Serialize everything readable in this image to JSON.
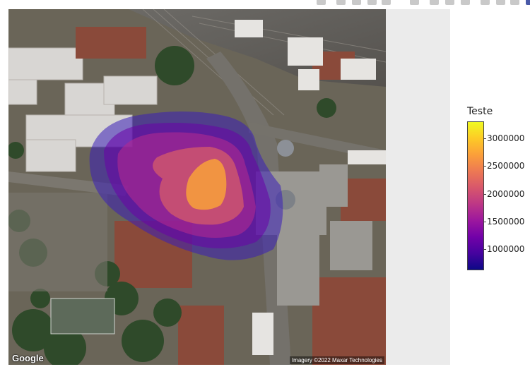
{
  "toolbar": {
    "icons": [
      "camera-icon",
      "zoom-icon",
      "pan-icon",
      "box-select-icon",
      "lasso-icon",
      "zoom-in-icon",
      "zoom-out-icon",
      "autoscale-icon",
      "reset-axes-icon",
      "toggle-spike-icon",
      "hover-closest-icon",
      "hover-compare-icon",
      "plotly-logo-icon"
    ]
  },
  "map": {
    "logo_text": "Google",
    "attribution": "Imagery ©2022 Maxar Technologies"
  },
  "colorbar": {
    "title": "Teste",
    "min": 650000,
    "max": 3300000,
    "colorscale": [
      "#0d0887",
      "#46039f",
      "#7201a8",
      "#9c179e",
      "#bd3786",
      "#d8576b",
      "#ed7953",
      "#fb9f3a",
      "#fdca26",
      "#f0f921"
    ],
    "ticks": [
      {
        "value": 3000000,
        "label": "3000000"
      },
      {
        "value": 2500000,
        "label": "2500000"
      },
      {
        "value": 2000000,
        "label": "2000000"
      },
      {
        "value": 1500000,
        "label": "1500000"
      },
      {
        "value": 1000000,
        "label": "1000000"
      }
    ]
  },
  "chart_data": {
    "type": "heatmap",
    "title": "",
    "colorbar_title": "Teste",
    "value_range": [
      650000,
      3300000
    ],
    "levels": [
      1000000,
      1500000,
      2000000,
      2500000,
      3000000
    ]
  }
}
